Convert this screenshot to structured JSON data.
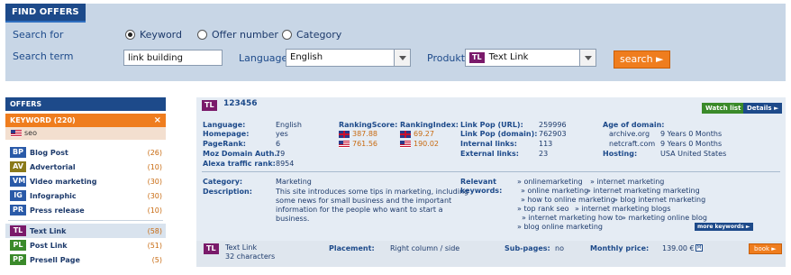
{
  "search": {
    "title": "FIND OFFERS",
    "search_for_label": "Search for",
    "options": [
      "Keyword",
      "Offer number",
      "Category"
    ],
    "search_term_label": "Search term",
    "search_term_value": "link building",
    "language_label": "Language",
    "language_value": "English",
    "produkt_label": "Produkt",
    "produkt_badge": "TL",
    "produkt_value": "Text Link",
    "search_button": "search ►"
  },
  "sidebar": {
    "header": "OFFERS",
    "keyword": "KEYWORD (220)",
    "close": "×",
    "seo": "seo",
    "group1": [
      {
        "badge": "BP",
        "label": "Blog Post",
        "count": "(26)"
      },
      {
        "badge": "AV",
        "label": "Advertorial",
        "count": "(10)"
      },
      {
        "badge": "VM",
        "label": "Video marketing",
        "count": "(30)"
      },
      {
        "badge": "IG",
        "label": "Infographic",
        "count": "(30)"
      },
      {
        "badge": "PR",
        "label": "Press release",
        "count": "(10)"
      }
    ],
    "group2": [
      {
        "badge": "TL",
        "label": "Text Link",
        "count": "(58)"
      },
      {
        "badge": "PL",
        "label": "Post Link",
        "count": "(51)"
      },
      {
        "badge": "PP",
        "label": "Presell Page",
        "count": "(5)"
      }
    ]
  },
  "offer": {
    "badge": "TL",
    "id": "123456",
    "watch_btn": "Watch list",
    "details_btn": "Details ►",
    "labels1": [
      "Language:",
      "Homepage:",
      "PageRank:",
      "Moz Domain Auth.:",
      "Alexa traffic rank:"
    ],
    "values1": [
      "English",
      "yes",
      "6",
      "79",
      "8954"
    ],
    "ranking_score_label": "RankingScore:",
    "ranking_score": [
      "387.88",
      "761.56"
    ],
    "ranking_index_label": "RankingIndex:",
    "ranking_index": [
      "69.27",
      "190.02"
    ],
    "labels3": [
      "Link Pop (URL):",
      "Link Pop (domain):",
      "Internal links:",
      "External links:"
    ],
    "values3": [
      "259996",
      "762903",
      "113",
      "23"
    ],
    "age_label": "Age of domain:",
    "age_sites": [
      "archive.org",
      "netcraft.com"
    ],
    "age_values": [
      "9 Years 0 Months",
      "9 Years 0 Months"
    ],
    "hosting_label": "Hosting:",
    "hosting_value": "USA United States",
    "category_label": "Category:",
    "category_value": "Marketing",
    "description_label": "Description:",
    "description_lines": [
      "This site introduces some tips in marketing, including",
      "some news for small business and the important",
      "information for the people who want to start a",
      "business."
    ],
    "relevant_label": "Relevant",
    "keywords_label": "keywords:",
    "keyword_rows": [
      [
        "» onlinemarketing",
        "» internet marketing"
      ],
      [
        "» online marketing",
        "» internet marketing marketing"
      ],
      [
        "» how to online marketing",
        "» blog internet marketing"
      ],
      [
        "» top rank seo",
        "» internet marketing blogs"
      ],
      [
        "» internet marketing how to",
        "» marketing online blog"
      ],
      [
        "» blog online marketing"
      ]
    ],
    "more_keywords": "more keywords ►"
  },
  "footer": {
    "badge": "TL",
    "name": "Text Link",
    "chars": "32 characters",
    "placement_label": "Placement:",
    "placement_value": "Right column / side",
    "subpages_label": "Sub-pages:",
    "subpages_value": "no",
    "price_label": "Monthly price:",
    "price_value": "139.00 €",
    "book_btn": "book ►"
  }
}
